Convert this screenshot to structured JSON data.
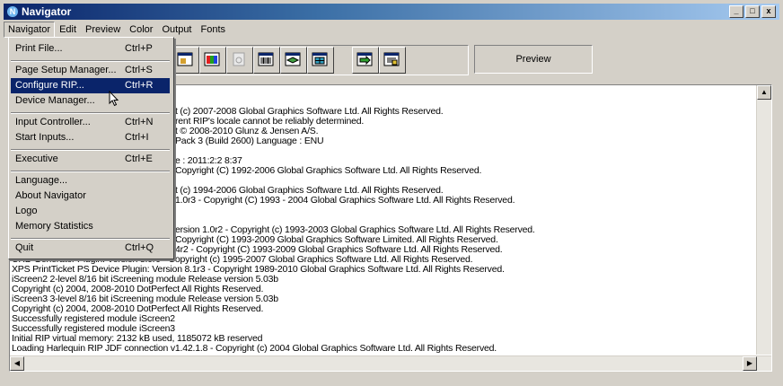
{
  "window": {
    "title": "Navigator",
    "app_icon_letter": "N",
    "minimize": "_",
    "maximize": "□",
    "close": "x"
  },
  "menubar": [
    "Navigator",
    "Edit",
    "Preview",
    "Color",
    "Output",
    "Fonts"
  ],
  "toolbar": {
    "preview_label": "Preview"
  },
  "dropdown": [
    {
      "label": "Print File...",
      "shortcut": "Ctrl+P"
    },
    {
      "label": "Page Setup Manager...",
      "shortcut": "Ctrl+S"
    },
    {
      "label": "Configure RIP...",
      "shortcut": "Ctrl+R"
    },
    {
      "label": "Device Manager...",
      "shortcut": ""
    },
    {
      "label": "Input Controller...",
      "shortcut": "Ctrl+N"
    },
    {
      "label": "Start Inputs...",
      "shortcut": "Ctrl+I"
    },
    {
      "label": "Executive",
      "shortcut": "Ctrl+E"
    },
    {
      "label": "Language...",
      "shortcut": ""
    },
    {
      "label": "About Navigator",
      "shortcut": ""
    },
    {
      "label": "Logo",
      "shortcut": ""
    },
    {
      "label": "Memory Statistics",
      "shortcut": ""
    },
    {
      "label": "Quit",
      "shortcut": "Ctrl+Q"
    }
  ],
  "log": [
    "t (c) 2007-2008 Global Graphics Software Ltd. All Rights Reserved.",
    "rent RIP's locale cannot be reliably determined.",
    "t © 2008-2010 Glunz & Jensen A/S.",
    "Pack 3 (Build 2600)  Language : ENU",
    "e : 2011:2:2 8:37",
    "Copyright (C) 1992-2006 Global Graphics Software Ltd. All Rights Reserved.",
    "t (c) 1994-2006 Global Graphics Software Ltd. All Rights Reserved.",
    "1.0r3 - Copyright (C) 1993 - 2004 Global Graphics Software Ltd. All Rights Reserved.",
    "ersion 1.0r2 - Copyright (c) 1993-2003 Global Graphics Software Ltd.  All Rights Reserved.",
    "Copyright (C) 1993-2009 Global Graphics Software Limited. All Rights Reserved.",
    "4r2 - Copyright (C) 1993-2009 Global Graphics Software Ltd. All Rights Reserved.",
    "CRD Generator Plugin: Version 8.0r0 - Copyright (c) 1995-2007 Global Graphics Software Ltd. All Rights Reserved.",
    "XPS PrintTicket PS Device Plugin: Version 8.1r3 - Copyright 1989-2010 Global Graphics Software Ltd. All Rights Reserved.",
    "iScreen2  2-level 8/16 bit iScreening module Release version 5.03b",
    "  Copyright (c) 2004, 2008-2010 DotPerfect All Rights Reserved.",
    "iScreen3  3-level 8/16 bit iScreening module Release version 5.03b",
    "  Copyright (c) 2004, 2008-2010 DotPerfect All Rights Reserved.",
    "Successfully registered module iScreen2",
    "Successfully registered module iScreen3",
    "Initial RIP virtual memory: 2132 kB used, 1185072 kB reserved",
    "Loading Harlequin RIP JDF connection v1.42.1.8 - Copyright (c) 2004 Global Graphics Software Ltd. All Rights Reserved."
  ]
}
